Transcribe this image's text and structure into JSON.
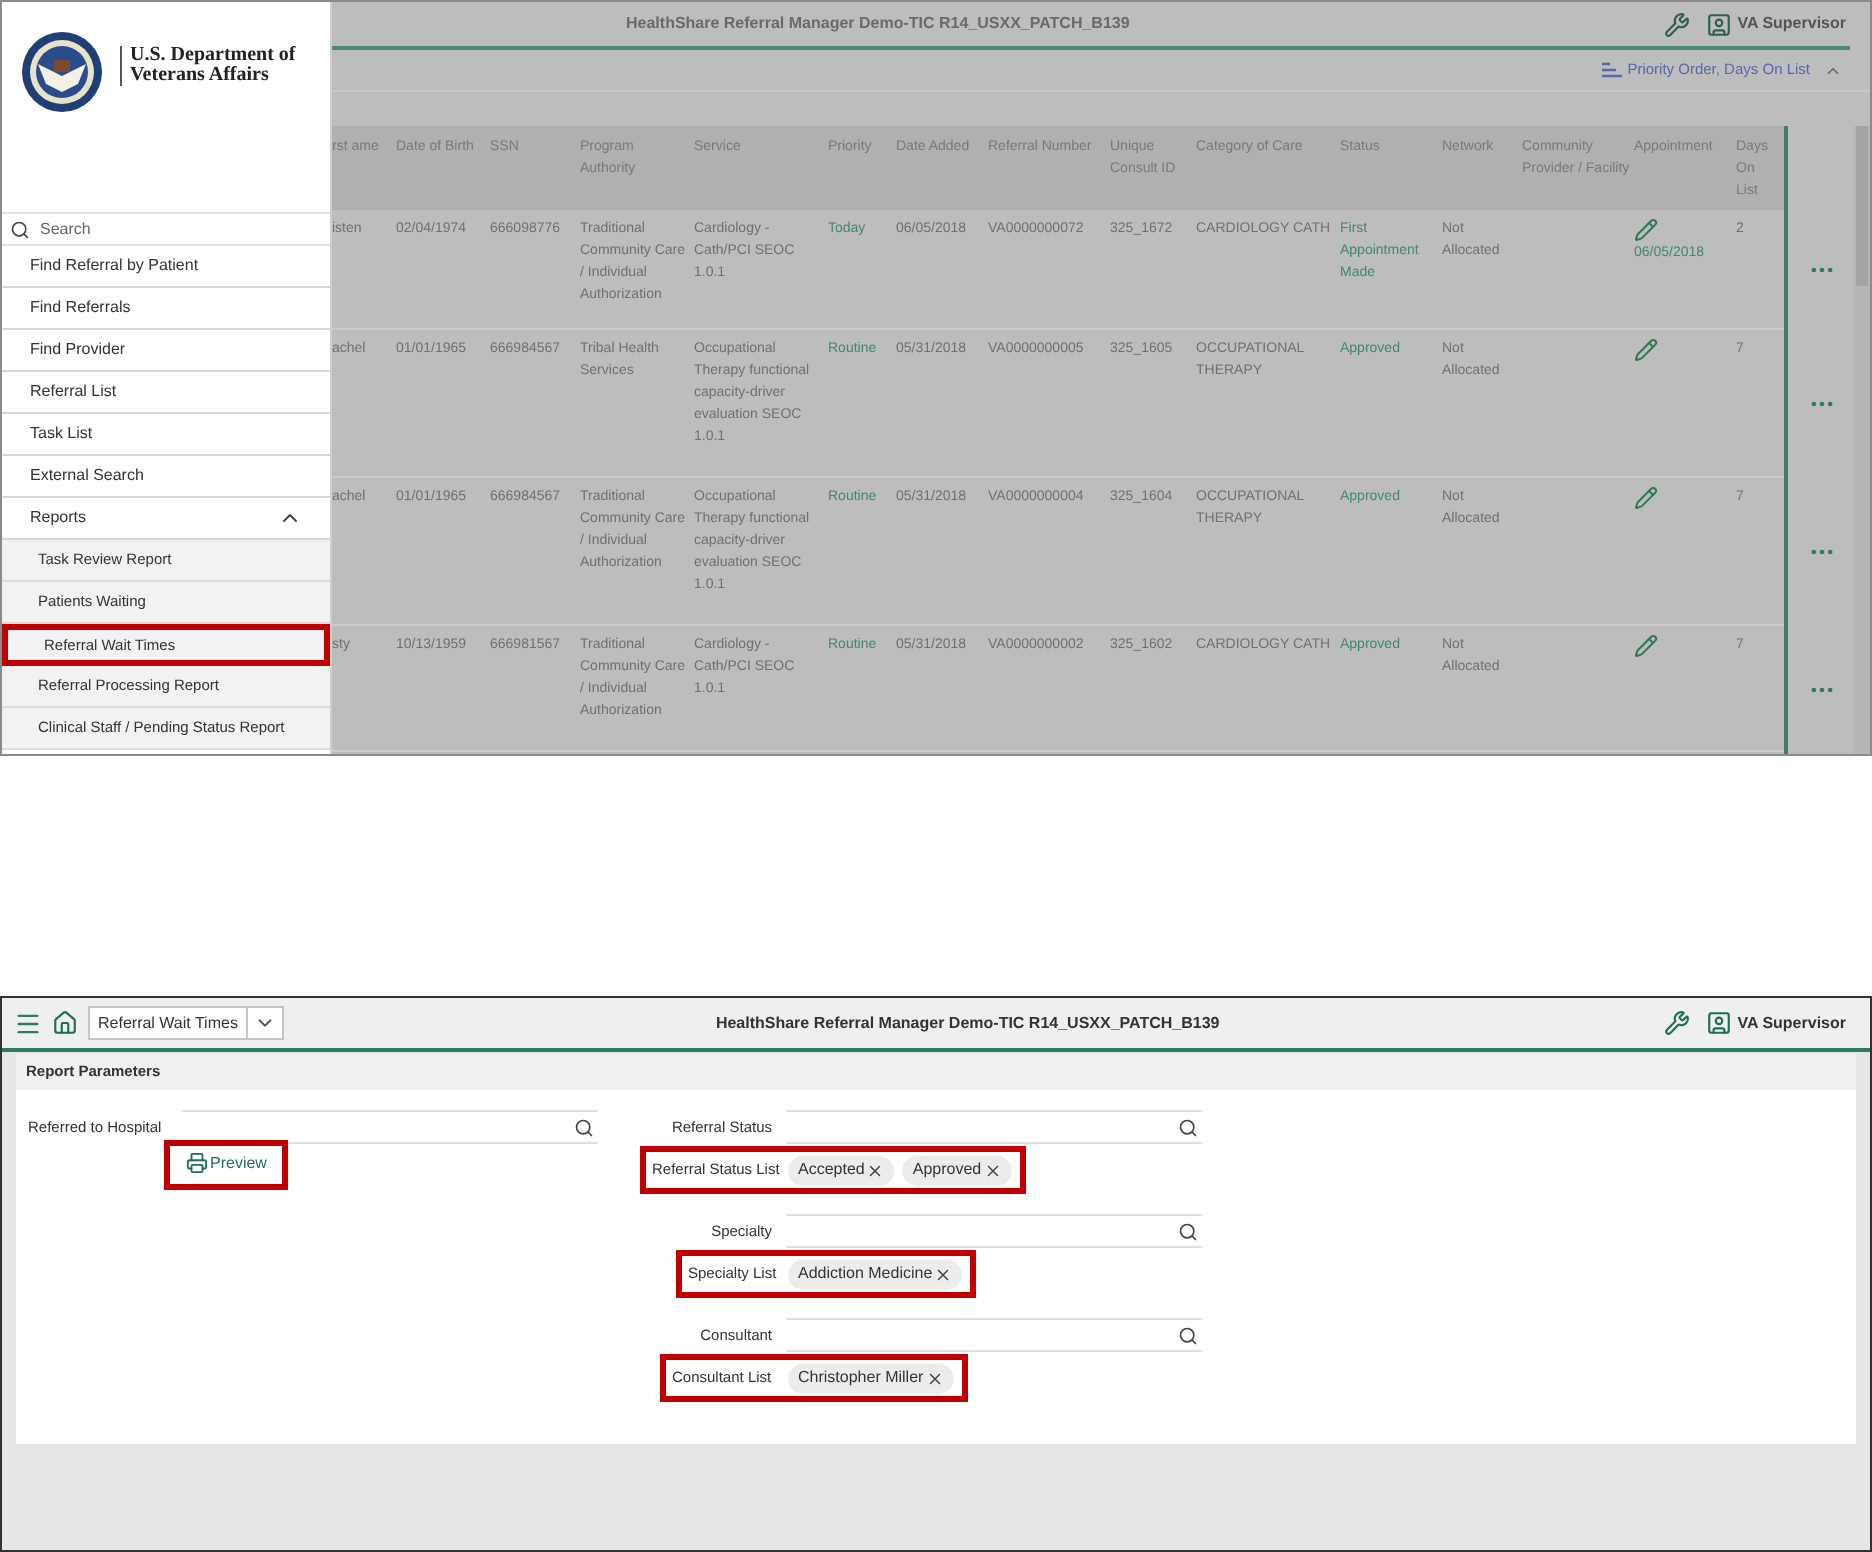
{
  "top_screen": {
    "title": "HealthShare Referral Manager Demo-TIC R14_USXX_PATCH_B139",
    "user": "VA Supervisor",
    "drawer": {
      "org_lines": [
        "U.S. Department of",
        "Veterans Affairs"
      ],
      "search_placeholder": "Search",
      "items": [
        {
          "label": "Find Referral by Patient"
        },
        {
          "label": "Find Referrals"
        },
        {
          "label": "Find Provider"
        },
        {
          "label": "Referral List"
        },
        {
          "label": "Task List"
        },
        {
          "label": "External Search"
        },
        {
          "label": "Reports",
          "expanded": true,
          "children": [
            {
              "label": "Task Review Report",
              "highlighted": false
            },
            {
              "label": "Patients Waiting",
              "highlighted": false
            },
            {
              "label": "Referral Wait Times",
              "highlighted": true
            },
            {
              "label": "Referral Processing Report",
              "highlighted": false
            },
            {
              "label": "Clinical Staff / Pending Status Report",
              "highlighted": false
            }
          ]
        }
      ]
    },
    "sort_label": "Priority Order, Days On List",
    "table": {
      "columns": [
        {
          "label": "rst ame",
          "kind": "text"
        },
        {
          "label": "Date of Birth",
          "kind": "text"
        },
        {
          "label": "SSN",
          "kind": "text"
        },
        {
          "label": "Program Authority",
          "kind": "text"
        },
        {
          "label": "Service",
          "kind": "text"
        },
        {
          "label": "Priority",
          "kind": "accent"
        },
        {
          "label": "Date Added",
          "kind": "text"
        },
        {
          "label": "Referral Number",
          "kind": "text"
        },
        {
          "label": "Unique Consult ID",
          "kind": "text"
        },
        {
          "label": "Category of Care",
          "kind": "text"
        },
        {
          "label": "Status",
          "kind": "accent"
        },
        {
          "label": "Network",
          "kind": "text"
        },
        {
          "label": "Community Provider / Facility",
          "kind": "text"
        },
        {
          "label": "Appointment",
          "kind": "appointment"
        },
        {
          "label": "Days On List",
          "kind": "text"
        }
      ],
      "rows": [
        {
          "cells": [
            "isten",
            "02/04/1974",
            "666098776",
            "Traditional Community Care / Individual Authorization",
            "Cardiology - Cath/PCI SEOC 1.0.1",
            "Today",
            "06/05/2018",
            "VA0000000072",
            "325_1672",
            "CARDIOLOGY CATH",
            "First Appointment Made",
            "Not Allocated",
            "",
            "06/05/2018",
            "2"
          ]
        },
        {
          "cells": [
            "achel",
            "01/01/1965",
            "666984567",
            "Tribal Health Services",
            "Occupational Therapy functional capacity-driver evaluation SEOC 1.0.1",
            "Routine",
            "05/31/2018",
            "VA0000000005",
            "325_1605",
            "OCCUPATIONAL THERAPY",
            "Approved",
            "Not Allocated",
            "",
            "",
            "7"
          ]
        },
        {
          "cells": [
            "achel",
            "01/01/1965",
            "666984567",
            "Traditional Community Care / Individual Authorization",
            "Occupational Therapy functional capacity-driver evaluation SEOC 1.0.1",
            "Routine",
            "05/31/2018",
            "VA0000000004",
            "325_1604",
            "OCCUPATIONAL THERAPY",
            "Approved",
            "Not Allocated",
            "",
            "",
            "7"
          ]
        },
        {
          "cells": [
            "sty",
            "10/13/1959",
            "666981567",
            "Traditional Community Care / Individual Authorization",
            "Cardiology - Cath/PCI SEOC 1.0.1",
            "Routine",
            "05/31/2018",
            "VA0000000002",
            "325_1602",
            "CARDIOLOGY CATH",
            "Approved",
            "Not Allocated",
            "",
            "",
            "7"
          ]
        }
      ]
    }
  },
  "bottom_screen": {
    "page_select": "Referral Wait Times",
    "title": "HealthShare Referral Manager Demo-TIC R14_USXX_PATCH_B139",
    "user": "VA Supervisor",
    "section_title": "Report Parameters",
    "hospital_label": "Referred to Hospital",
    "preview": {
      "label": "Preview",
      "highlighted": true
    },
    "filters": [
      {
        "label": "Referral Status",
        "list_label": "Referral Status List",
        "chips": [
          "Accepted",
          "Approved"
        ],
        "highlighted": true
      },
      {
        "label": "Specialty",
        "list_label": "Specialty List",
        "chips": [
          "Addiction Medicine"
        ],
        "highlighted": true
      },
      {
        "label": "Consultant",
        "list_label": "Consultant List",
        "chips": [
          "Christopher Miller"
        ],
        "highlighted": true
      }
    ]
  }
}
